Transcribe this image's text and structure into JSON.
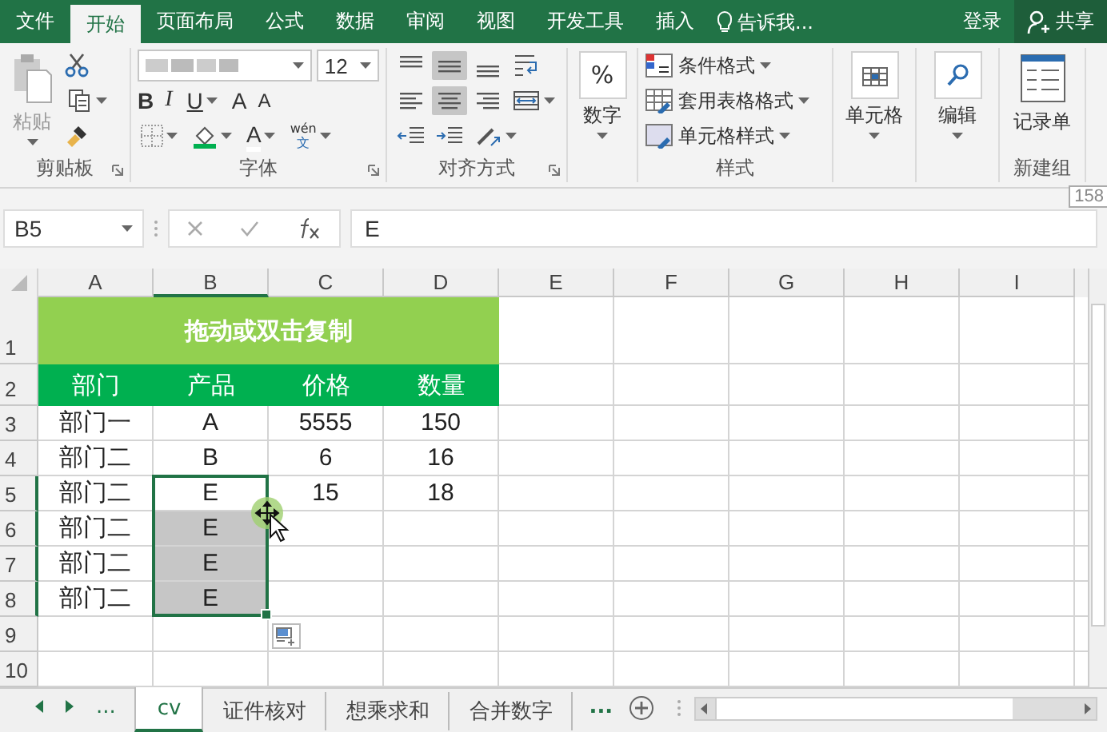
{
  "ribbon_tabs": [
    {
      "label": "文件",
      "selected": false
    },
    {
      "label": "开始",
      "selected": true
    },
    {
      "label": "页面布局",
      "selected": false
    },
    {
      "label": "公式",
      "selected": false
    },
    {
      "label": "数据",
      "selected": false
    },
    {
      "label": "审阅",
      "selected": false
    },
    {
      "label": "视图",
      "selected": false
    },
    {
      "label": "开发工具",
      "selected": false
    },
    {
      "label": "插入",
      "selected": false
    }
  ],
  "tell_me": {
    "placeholder": "告诉我..."
  },
  "sign_in": "登录",
  "share": "共享",
  "ribbon": {
    "clipboard": {
      "paste": "粘贴",
      "label": "剪贴板"
    },
    "font": {
      "size": "12",
      "bold": "B",
      "italic": "I",
      "underline": "U",
      "grow": "A",
      "shrink": "A",
      "font_color": "A",
      "phonetic_top": "wén",
      "phonetic_bottom": "文",
      "label": "字体"
    },
    "alignment": {
      "buttons": [
        {
          "kind": "top",
          "selected": false
        },
        {
          "kind": "middle",
          "selected": true
        },
        {
          "kind": "bottom",
          "selected": false
        },
        {
          "kind": "wrap",
          "selected": false
        },
        {
          "kind": "left",
          "selected": false
        },
        {
          "kind": "center",
          "selected": true
        },
        {
          "kind": "right",
          "selected": false
        },
        {
          "kind": "merge",
          "selected": false
        },
        {
          "kind": "outdent",
          "selected": false
        },
        {
          "kind": "indent",
          "selected": false
        },
        {
          "kind": "orientation",
          "selected": false
        }
      ],
      "label": "对齐方式"
    },
    "number": {
      "symbol": "%",
      "label": "数字"
    },
    "styles": {
      "items": [
        "条件格式",
        "套用表格格式",
        "单元格样式"
      ],
      "label": "样式"
    },
    "cells": {
      "label": "单元格"
    },
    "editing": {
      "label": "编辑"
    },
    "new_group": {
      "button": "记录单",
      "label": "新建组"
    }
  },
  "tooltip": "158",
  "formula_bar": {
    "name_box": "B5",
    "value": "E"
  },
  "sheet": {
    "columns": [
      {
        "label": "A",
        "selected": false
      },
      {
        "label": "B",
        "selected": true
      },
      {
        "label": "C",
        "selected": false
      },
      {
        "label": "D",
        "selected": false
      },
      {
        "label": "E",
        "selected": false
      },
      {
        "label": "F",
        "selected": false
      },
      {
        "label": "G",
        "selected": false
      },
      {
        "label": "H",
        "selected": false
      },
      {
        "label": "I",
        "selected": false
      }
    ],
    "rows": [
      {
        "number": "1",
        "kind": "title",
        "selected": false,
        "cells": [
          "拖动或双击复制"
        ]
      },
      {
        "number": "2",
        "kind": "header",
        "selected": false,
        "cells": [
          "部门",
          "产品",
          "价格",
          "数量"
        ]
      },
      {
        "number": "3",
        "kind": "data",
        "selected": false,
        "cells": [
          "部门一",
          "A",
          "5555",
          "150"
        ]
      },
      {
        "number": "4",
        "kind": "data",
        "selected": false,
        "cells": [
          "部门二",
          "B",
          "6",
          "16"
        ]
      },
      {
        "number": "5",
        "kind": "data",
        "selected": true,
        "preview": false,
        "cells": [
          "部门二",
          "E",
          "15",
          "18"
        ]
      },
      {
        "number": "6",
        "kind": "data",
        "selected": true,
        "preview": true,
        "cells": [
          "部门二",
          "E"
        ]
      },
      {
        "number": "7",
        "kind": "data",
        "selected": true,
        "preview": true,
        "cells": [
          "部门二",
          "E"
        ]
      },
      {
        "number": "8",
        "kind": "data",
        "selected": true,
        "preview": true,
        "cells": [
          "部门二",
          "E"
        ]
      },
      {
        "number": "9",
        "kind": "data",
        "selected": false
      },
      {
        "number": "10",
        "kind": "data",
        "selected": false
      }
    ]
  },
  "sheet_tabs": {
    "more_left": "...",
    "tabs": [
      {
        "label": "cv",
        "selected": true
      },
      {
        "label": "证件核对",
        "selected": false
      },
      {
        "label": "想乘求和",
        "selected": false
      },
      {
        "label": "合并数字",
        "selected": false
      }
    ],
    "more_right": "..."
  }
}
